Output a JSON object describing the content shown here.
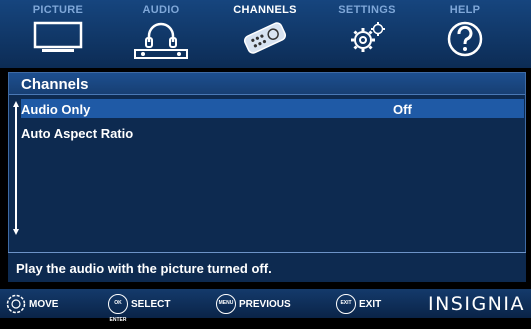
{
  "tabs": [
    {
      "label": "PICTURE",
      "icon": "tv-icon"
    },
    {
      "label": "AUDIO",
      "icon": "headphones-icon"
    },
    {
      "label": "CHANNELS",
      "icon": "remote-icon",
      "active": true
    },
    {
      "label": "SETTINGS",
      "icon": "gears-icon"
    },
    {
      "label": "HELP",
      "icon": "question-icon"
    }
  ],
  "panel": {
    "title": "Channels",
    "items": [
      {
        "label": "Audio Only",
        "value": "Off",
        "selected": true
      },
      {
        "label": "Auto Aspect Ratio",
        "value": ""
      }
    ]
  },
  "help_text": "Play the audio with the picture turned off.",
  "footer": {
    "hints": [
      {
        "button": "",
        "label": "MOVE"
      },
      {
        "button": "OK ENTER",
        "label": "SELECT"
      },
      {
        "button": "MENU",
        "label": "PREVIOUS"
      },
      {
        "button": "EXIT",
        "label": "EXIT"
      }
    ],
    "brand": "INSIGNIA"
  },
  "colors": {
    "background": "#0d2a50",
    "selected_row": "#1f5aa6",
    "tab_inactive": "#7fa7d8",
    "tab_active": "#ffffff"
  }
}
